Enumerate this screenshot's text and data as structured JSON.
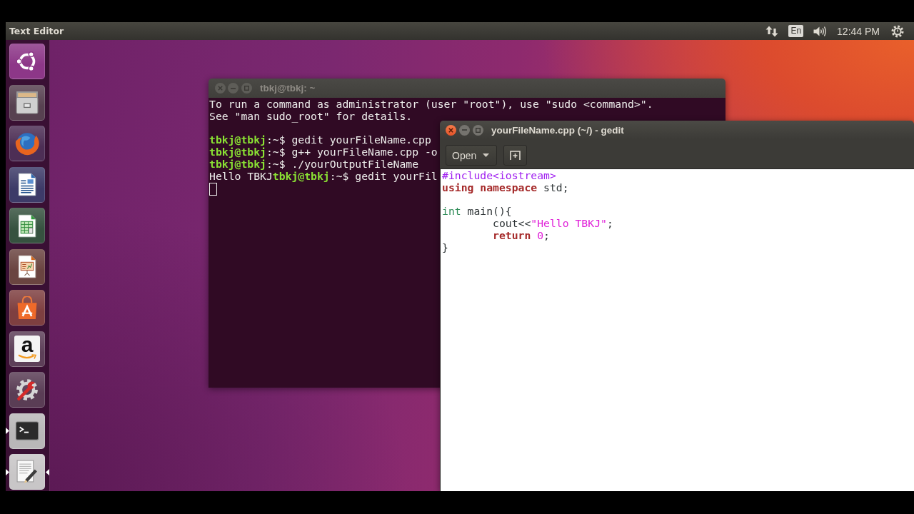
{
  "top_panel": {
    "app_title": "Text Editor",
    "indicators": [
      {
        "kind": "network"
      },
      {
        "kind": "keyboard",
        "text": "En"
      },
      {
        "kind": "sound"
      },
      {
        "kind": "clock",
        "text": "12:44 PM"
      },
      {
        "kind": "session"
      }
    ]
  },
  "launcher": {
    "items": [
      {
        "kind": "home",
        "running": false,
        "focused": false
      },
      {
        "kind": "files",
        "running": false,
        "focused": false
      },
      {
        "kind": "browser",
        "running": false,
        "focused": false
      },
      {
        "kind": "document",
        "running": false,
        "focused": false
      },
      {
        "kind": "spreadsheet",
        "running": false,
        "focused": false
      },
      {
        "kind": "presentation",
        "running": false,
        "focused": false
      },
      {
        "kind": "software",
        "running": false,
        "focused": false
      },
      {
        "kind": "shop",
        "text": "a",
        "running": false,
        "focused": false
      },
      {
        "kind": "settings",
        "running": false,
        "focused": false
      },
      {
        "kind": "terminal",
        "running": true,
        "focused": false
      },
      {
        "kind": "editor",
        "running": true,
        "focused": true
      }
    ]
  },
  "terminal_window": {
    "title": "tbkj@tbkj: ~",
    "active": false,
    "blocks": [
      [
        {
          "segments": [
            {
              "kind": "plain",
              "text": "To run a command as administrator (user \"root\"), use \"sudo <command>\"."
            }
          ]
        },
        {
          "segments": [
            {
              "kind": "plain",
              "text": "See \"man sudo_root\" for details."
            }
          ]
        }
      ],
      [
        {
          "segments": [
            {
              "kind": "user",
              "text": "tbkj@tbkj"
            },
            {
              "kind": "plain",
              "text": ":~$ gedit yourFileName.cpp"
            }
          ]
        },
        {
          "segments": [
            {
              "kind": "user",
              "text": "tbkj@tbkj"
            },
            {
              "kind": "plain",
              "text": ":~$ g++ yourFileName.cpp -o"
            }
          ]
        },
        {
          "segments": [
            {
              "kind": "user",
              "text": "tbkj@tbkj"
            },
            {
              "kind": "plain",
              "text": ":~$ ./yourOutputFileName"
            }
          ]
        },
        {
          "segments": [
            {
              "kind": "plain",
              "text": "Hello TBKJ"
            },
            {
              "kind": "user",
              "text": "tbkj@tbkj"
            },
            {
              "kind": "plain",
              "text": ":~$ gedit yourFil"
            }
          ]
        }
      ]
    ]
  },
  "editor_window": {
    "title": "yourFileName.cpp (~/) - gedit",
    "active": true,
    "open_button": "Open",
    "blocks": [
      [
        {
          "segments": [
            {
              "kind": "preprocessor",
              "text": "#include<iostream>"
            }
          ]
        },
        {
          "segments": [
            {
              "kind": "keyword",
              "text": "using namespace"
            },
            {
              "kind": "plain",
              "text": " std;"
            }
          ]
        }
      ],
      [
        {
          "segments": [
            {
              "kind": "type",
              "text": "int"
            },
            {
              "kind": "plain",
              "text": " main(){"
            }
          ]
        },
        {
          "segments": [
            {
              "kind": "plain",
              "text": "        cout<<"
            },
            {
              "kind": "string",
              "text": "\"Hello TBKJ\""
            },
            {
              "kind": "plain",
              "text": ";"
            }
          ]
        },
        {
          "segments": [
            {
              "kind": "keyword",
              "text": "        return"
            },
            {
              "kind": "number",
              "text": " 0"
            },
            {
              "kind": "plain",
              "text": ";"
            }
          ]
        },
        {
          "segments": [
            {
              "kind": "plain",
              "text": "}"
            }
          ]
        }
      ]
    ]
  }
}
